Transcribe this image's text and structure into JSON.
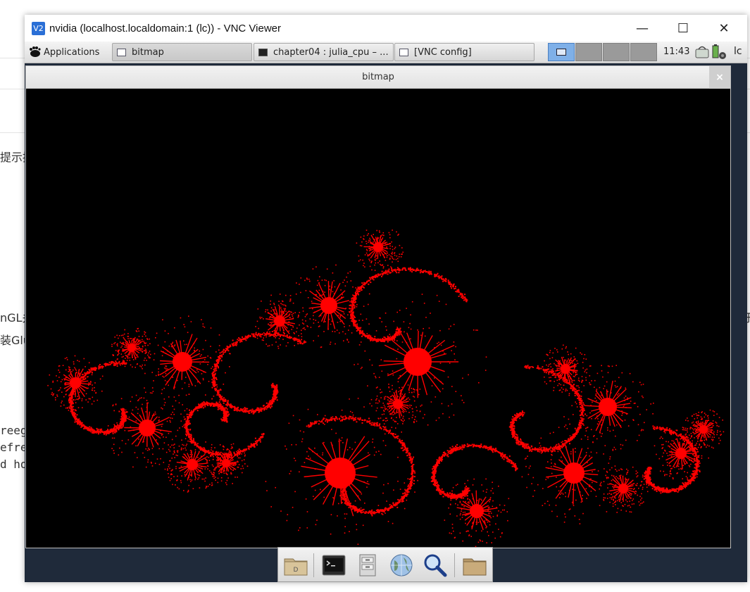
{
  "background": {
    "frag_1": "提示持",
    "frag_2": "nGL关",
    "frag_3": "装Glu",
    "frag_4": "reeg",
    "frag_5": "efre",
    "frag_6": "d ho",
    "frag_right": "于"
  },
  "vnc": {
    "title": "nvidia (localhost.localdomain:1 (lc)) - VNC Viewer",
    "logo_text": "V2",
    "minimize": "—",
    "maximize": "☐",
    "close": "✕"
  },
  "panel": {
    "apps_label": "Applications",
    "tasks": [
      {
        "label": "bitmap"
      },
      {
        "label": "chapter04 : julia_cpu – ..."
      },
      {
        "label": "[VNC config]"
      }
    ],
    "clock": "11:43",
    "user": "lc"
  },
  "app": {
    "title": "bitmap",
    "close": "×"
  },
  "dock": {
    "items": [
      "home-folder-icon",
      "terminal-icon",
      "file-cabinet-icon",
      "web-browser-icon",
      "search-icon",
      "folder-icon"
    ]
  },
  "colors": {
    "fractal": "#ff0000",
    "canvas": "#000000",
    "desktop": "#1f2a3a"
  }
}
